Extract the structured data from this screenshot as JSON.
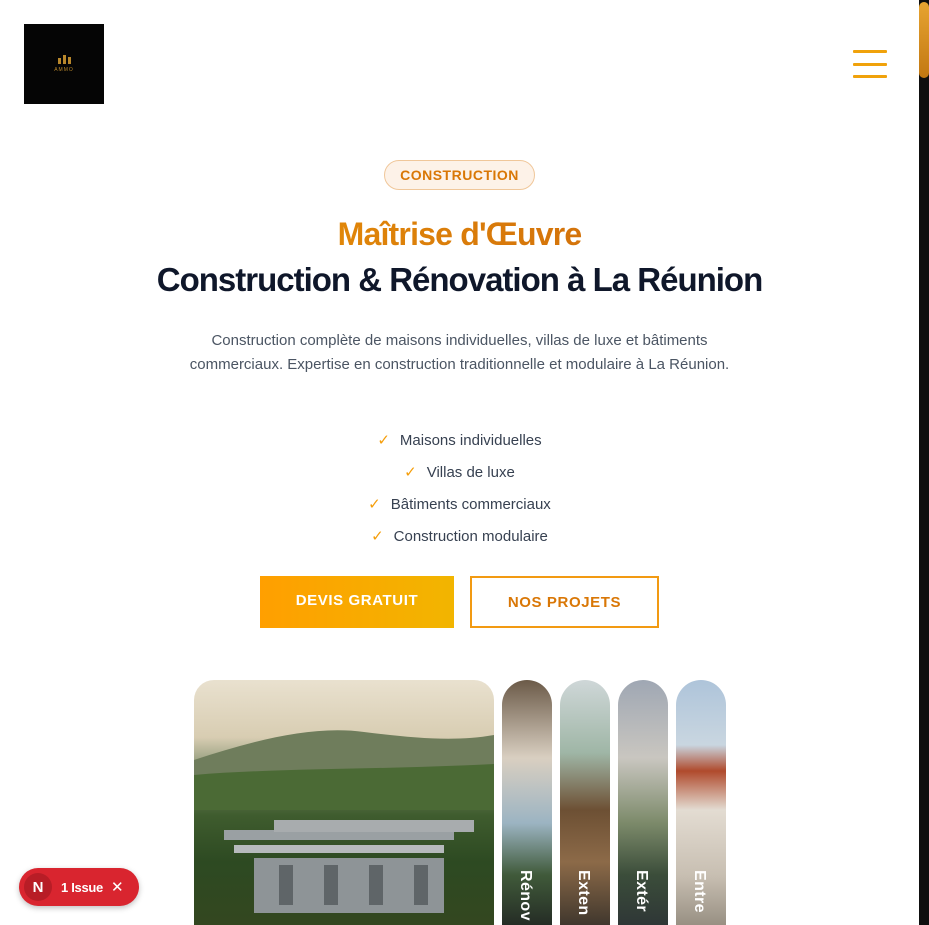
{
  "header": {
    "logo_text": "AMMO",
    "menu_icon": "hamburger-menu-icon"
  },
  "hero": {
    "badge": "CONSTRUCTION",
    "title_accent": "Maîtrise d'Œuvre",
    "title_main": "Construction & Rénovation à La Réunion",
    "description": "Construction complète de maisons individuelles, villas de luxe et bâtiments commerciaux. Expertise en construction traditionnelle et modulaire à La Réunion.",
    "features": [
      "Maisons individuelles",
      "Villas de luxe",
      "Bâtiments commerciaux",
      "Construction modulaire"
    ],
    "primary_button": "DEVIS GRATUIT",
    "secondary_button": "NOS PROJETS"
  },
  "gallery": {
    "panels": [
      {
        "label": "Rénov"
      },
      {
        "label": "Exten"
      },
      {
        "label": "Extér"
      },
      {
        "label": "Entre"
      }
    ]
  },
  "issue_badge": {
    "letter": "N",
    "label": "1 Issue",
    "close": "✕"
  },
  "colors": {
    "accent": "#f59e0b",
    "accent_dark": "#d97706",
    "heading": "#0f172a",
    "text": "#4b5563",
    "issue_red": "#d9252f"
  }
}
